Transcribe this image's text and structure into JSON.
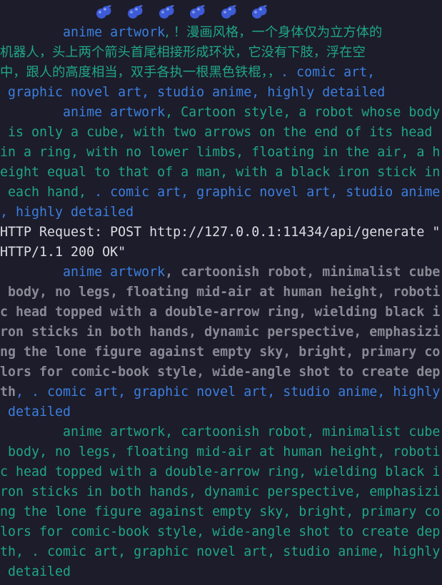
{
  "icons": [
    {
      "name": "blueberry-icon",
      "color": "#3d5bd6"
    },
    {
      "name": "blueberry-icon",
      "color": "#3d5bd6"
    },
    {
      "name": "blueberry-icon",
      "color": "#3d5bd6"
    },
    {
      "name": "blueberry-icon",
      "color": "#3d5bd6"
    },
    {
      "name": "blueberry-icon",
      "color": "#3d5bd6"
    },
    {
      "name": "blueberry-icon",
      "color": "#3d5bd6"
    }
  ],
  "colors": {
    "background": "#1d1c2a",
    "prefix_blue": "#3b7fe0",
    "prompt_green": "#1fa785",
    "prompt_gray": "#8a8a96",
    "log_white": "#dcdce4"
  },
  "lines": [
    [
      {
        "c": "blue",
        "t": "        anime artwork"
      },
      {
        "c": "green zh",
        "t": ", ！漫画风格，一个身体仅为立方体的"
      }
    ],
    [
      {
        "c": "green zh",
        "t": "机器人，头上两个箭头首尾相接形成环状，它没有下肢，浮在空"
      }
    ],
    [
      {
        "c": "green zh",
        "t": "中，跟人的高度相当，双手各执一根黑色铁棍，，"
      },
      {
        "c": "blue",
        "t": ". comic art,"
      }
    ],
    [
      {
        "c": "blue",
        "t": " graphic novel art, studio anime, highly detailed"
      }
    ],
    [
      {
        "c": "blue",
        "t": "        anime artwork"
      },
      {
        "c": "green",
        "t": ", Cartoon style, a robot whose body"
      }
    ],
    [
      {
        "c": "green",
        "t": " is only a cube, with two arrows on the end of its head"
      }
    ],
    [
      {
        "c": "green",
        "t": "in a ring, with no lower limbs, floating in the air, a h"
      }
    ],
    [
      {
        "c": "green",
        "t": "eight equal to that of a man, with a black iron stick in"
      }
    ],
    [
      {
        "c": "green",
        "t": " each hand, "
      },
      {
        "c": "blue",
        "t": ". comic art, graphic novel art, studio anime"
      }
    ],
    [
      {
        "c": "blue",
        "t": ", highly detailed"
      }
    ],
    [
      {
        "c": "white",
        "t": "HTTP Request: POST http://127.0.0.1:11434/api/generate \""
      }
    ],
    [
      {
        "c": "white",
        "t": "HTTP/1.1 200 OK\""
      }
    ],
    [
      {
        "c": "blue",
        "t": "        anime artwork"
      },
      {
        "c": "gray",
        "t": ", cartoonish robot, minimalist cube"
      }
    ],
    [
      {
        "c": "gray",
        "t": " body, no legs, floating mid-air at human height, roboti"
      }
    ],
    [
      {
        "c": "gray",
        "t": "c head topped with a double-arrow ring, wielding black i"
      }
    ],
    [
      {
        "c": "gray",
        "t": "ron sticks in both hands, dynamic perspective, emphasizi"
      }
    ],
    [
      {
        "c": "gray",
        "t": "ng the lone figure against empty sky, bright, primary co"
      }
    ],
    [
      {
        "c": "gray",
        "t": "lors for comic-book style, wide-angle shot to create dep"
      }
    ],
    [
      {
        "c": "gray",
        "t": "th"
      },
      {
        "c": "blue",
        "t": ", . comic art, graphic novel art, studio anime, highly"
      }
    ],
    [
      {
        "c": "blue",
        "t": " detailed"
      }
    ],
    [
      {
        "c": "green",
        "t": "        anime artwork, cartoonish robot, minimalist cube"
      }
    ],
    [
      {
        "c": "green",
        "t": " body, no legs, floating mid-air at human height, roboti"
      }
    ],
    [
      {
        "c": "green",
        "t": "c head topped with a double-arrow ring, wielding black i"
      }
    ],
    [
      {
        "c": "green",
        "t": "ron sticks in both hands, dynamic perspective, emphasizi"
      }
    ],
    [
      {
        "c": "green",
        "t": "ng the lone figure against empty sky, bright, primary co"
      }
    ],
    [
      {
        "c": "green",
        "t": "lors for comic-book style, wide-angle shot to create dep"
      }
    ],
    [
      {
        "c": "green",
        "t": "th, . comic art, graphic novel art, studio anime, highly"
      }
    ],
    [
      {
        "c": "green",
        "t": " detailed"
      }
    ]
  ]
}
